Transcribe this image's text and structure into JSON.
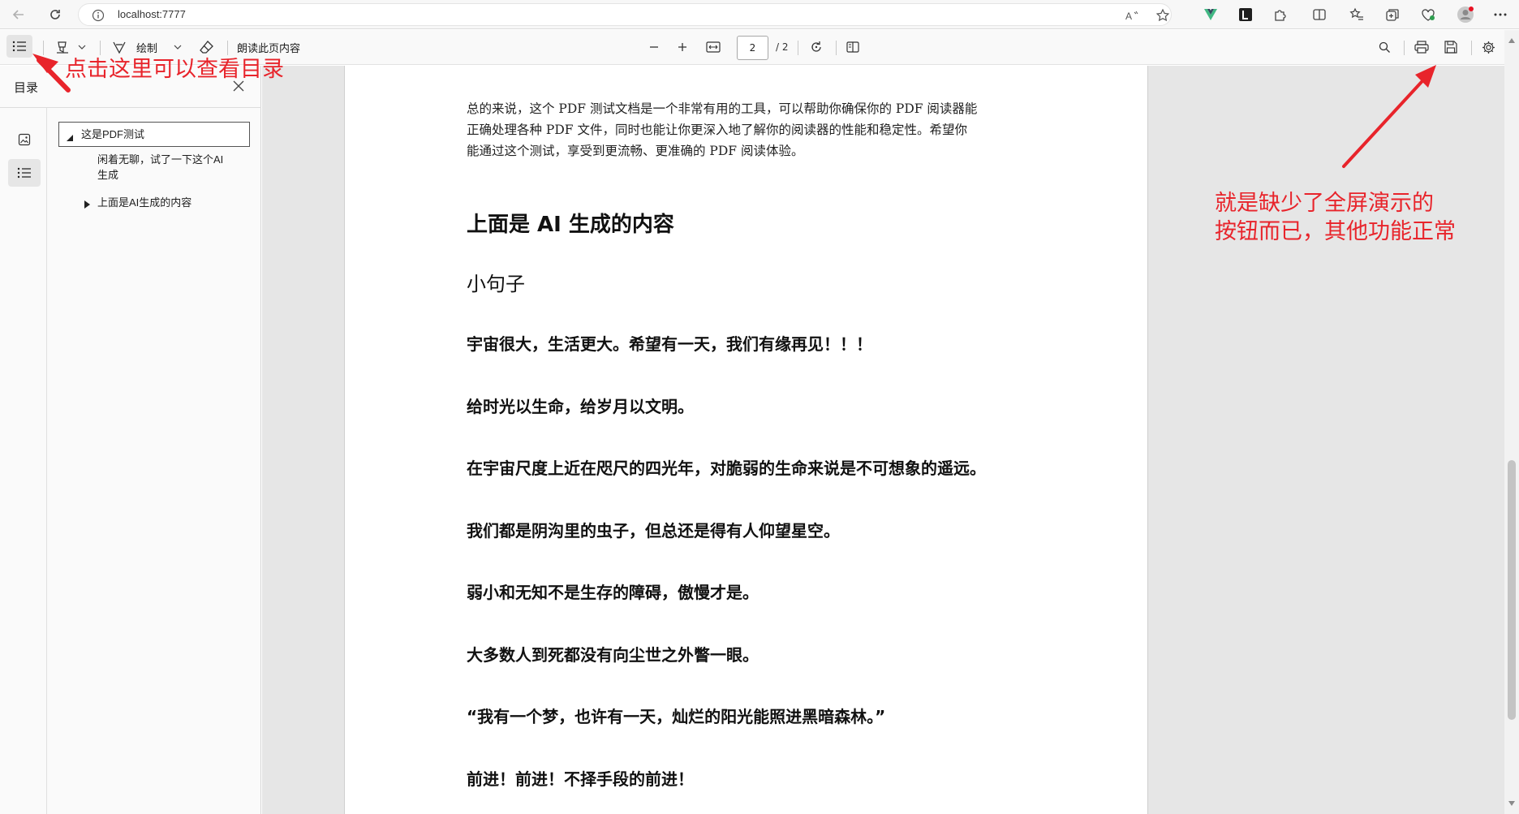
{
  "browser": {
    "url": "localhost:7777"
  },
  "toolbar": {
    "draw_label": "绘制",
    "read_aloud_label": "朗读此页内容",
    "current_page": "2",
    "total_pages": "/ 2"
  },
  "sidebar": {
    "title": "目录",
    "toc": [
      {
        "label": "这是PDF测试",
        "level": 0,
        "expanded": true,
        "selected": true
      },
      {
        "label_line1": "闲着无聊，试了一下这个AI",
        "label_line2": "生成",
        "level": 1
      },
      {
        "label": "上面是AI生成的内容",
        "level": 1,
        "expanded": false
      }
    ]
  },
  "document": {
    "paragraph_lines": [
      "总的来说，这个 PDF 测试文档是一个非常有用的工具，可以帮助你确保你的 PDF 阅读器能",
      "正确处理各种 PDF 文件，同时也能让你更深入地了解你的阅读器的性能和稳定性。希望你",
      "能通过这个测试，享受到更流畅、更准确的 PDF 阅读体验。"
    ],
    "heading": "上面是 AI 生成的内容",
    "subheading": "小句子",
    "lines": [
      "宇宙很大，生活更大。希望有一天，我们有缘再见！！！",
      "给时光以生命，给岁月以文明。",
      "在宇宙尺度上近在咫尺的四光年，对脆弱的生命来说是不可想象的遥远。",
      "我们都是阴沟里的虫子，但总还是得有人仰望星空。",
      "弱小和无知不是生存的障碍，傲慢才是。",
      "大多数人到死都没有向尘世之外瞥一眼。",
      "“我有一个梦，也许有一天，灿烂的阳光能照进黑暗森林。”",
      "前进！前进！不择手段的前进！"
    ]
  },
  "annotations": {
    "toc_hint": "点击这里可以查看目录",
    "fullscreen_note_line1": "就是缺少了全屏演示的",
    "fullscreen_note_line2": "按钮而已，其他功能正常",
    "color": "#e8242b"
  }
}
